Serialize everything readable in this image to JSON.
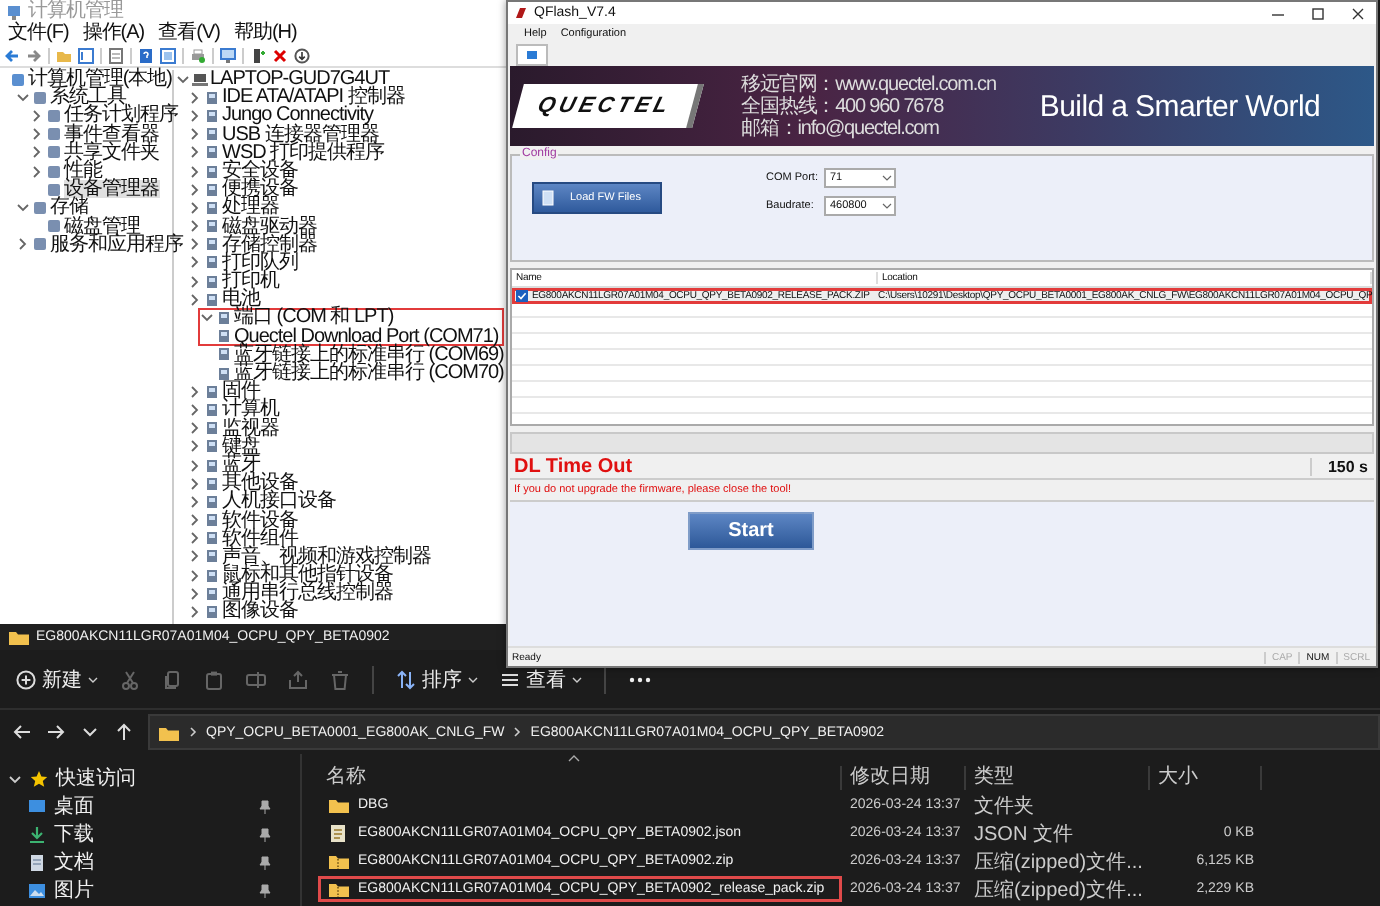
{
  "computer_management": {
    "title": "计算机管理",
    "menu": [
      "文件(F)",
      "操作(A)",
      "查看(V)",
      "帮助(H)"
    ],
    "console_tree": [
      {
        "label": "计算机管理(本地)",
        "selected": false,
        "children": [
          {
            "label": "系统工具",
            "expanded": true,
            "selected": false,
            "children": [
              {
                "label": "任务计划程序",
                "expanded": false,
                "selected": false
              },
              {
                "label": "事件查看器",
                "expanded": false,
                "selected": false
              },
              {
                "label": "共享文件夹",
                "expanded": false,
                "selected": false
              },
              {
                "label": "性能",
                "expanded": false,
                "selected": false
              },
              {
                "label": "设备管理器",
                "selected": true
              }
            ]
          },
          {
            "label": "存储",
            "expanded": true,
            "selected": false,
            "children": [
              {
                "label": "磁盘管理",
                "selected": false
              }
            ]
          },
          {
            "label": "服务和应用程序",
            "expanded": false,
            "selected": false
          }
        ]
      }
    ],
    "device_tree": {
      "label": "LAPTOP-GUD7G4UT",
      "expanded": true,
      "highlighted": false,
      "children": [
        {
          "label": "IDE ATA/ATAPI 控制器",
          "expanded": false,
          "highlighted": false
        },
        {
          "label": "Jungo Connectivity",
          "expanded": false,
          "highlighted": false
        },
        {
          "label": "USB 连接器管理器",
          "expanded": false,
          "highlighted": false
        },
        {
          "label": "WSD 打印提供程序",
          "expanded": false,
          "highlighted": false
        },
        {
          "label": "安全设备",
          "expanded": false,
          "highlighted": false
        },
        {
          "label": "便携设备",
          "expanded": false,
          "highlighted": false
        },
        {
          "label": "处理器",
          "expanded": false,
          "highlighted": false
        },
        {
          "label": "磁盘驱动器",
          "expanded": false,
          "highlighted": false
        },
        {
          "label": "存储控制器",
          "expanded": false,
          "highlighted": false
        },
        {
          "label": "打印队列",
          "expanded": false,
          "highlighted": false
        },
        {
          "label": "打印机",
          "expanded": false,
          "highlighted": false
        },
        {
          "label": "电池",
          "expanded": false,
          "highlighted": false
        },
        {
          "label": "端口 (COM 和 LPT)",
          "expanded": true,
          "highlighted": true,
          "children": [
            {
              "label": "Quectel Download Port (COM71)",
              "highlighted": true
            },
            {
              "label": "蓝牙链接上的标准串行 (COM69)",
              "highlighted": false
            },
            {
              "label": "蓝牙链接上的标准串行 (COM70)",
              "highlighted": false
            }
          ]
        },
        {
          "label": "固件",
          "expanded": false,
          "highlighted": false
        },
        {
          "label": "计算机",
          "expanded": false,
          "highlighted": false
        },
        {
          "label": "监视器",
          "expanded": false,
          "highlighted": false
        },
        {
          "label": "键盘",
          "expanded": false,
          "highlighted": false
        },
        {
          "label": "蓝牙",
          "expanded": false,
          "highlighted": false
        },
        {
          "label": "其他设备",
          "expanded": false,
          "highlighted": false
        },
        {
          "label": "人机接口设备",
          "expanded": false,
          "highlighted": false
        },
        {
          "label": "软件设备",
          "expanded": false,
          "highlighted": false
        },
        {
          "label": "软件组件",
          "expanded": false,
          "highlighted": false
        },
        {
          "label": "声音、视频和游戏控制器",
          "expanded": false,
          "highlighted": false
        },
        {
          "label": "鼠标和其他指针设备",
          "expanded": false,
          "highlighted": false
        },
        {
          "label": "通用串行总线控制器",
          "expanded": false,
          "highlighted": false
        },
        {
          "label": "图像设备",
          "expanded": false,
          "highlighted": false
        }
      ]
    }
  },
  "qflash": {
    "title": "QFlash_V7.4",
    "menu": [
      "Help",
      "Configuration"
    ],
    "banner": {
      "logo": "QUECTEL",
      "contact": [
        "移远官网：www.quectel.com.cn",
        "全国热线：400 960 7678",
        "邮箱：info@quectel.com"
      ],
      "slogan": "Build a Smarter World"
    },
    "config": {
      "legend": "Config",
      "load_button": "Load FW Files",
      "com_port": {
        "label": "COM Port:",
        "value": "71"
      },
      "baudrate": {
        "label": "Baudrate:",
        "value": "460800"
      }
    },
    "file_list": {
      "columns": [
        "Name",
        "Location"
      ],
      "rows": [
        {
          "name": "EG800AKCN11LGR07A01M04_OCPU_QPY_BETA0902_RELEASE_PACK.ZIP",
          "location": "C:\\Users\\10291\\Desktop\\QPY_OCPU_BETA0001_EG800AK_CNLG_FW\\EG800AKCN11LGR07A01M04_OCPU_QP",
          "checked": true,
          "highlighted": true
        }
      ]
    },
    "progress": {
      "level": 0
    },
    "timeout": {
      "label": "DL Time Out",
      "value": "150 s"
    },
    "warning": "If you do not upgrade the firmware, please close the tool!",
    "start_button": "Start",
    "status_bar": {
      "text": "Ready",
      "indicators": [
        {
          "label": "CAP",
          "on": false
        },
        {
          "label": "NUM",
          "on": true
        },
        {
          "label": "SCRL",
          "on": false
        }
      ]
    }
  },
  "explorer": {
    "title": "EG800AKCN11LGR07A01M04_OCPU_QPY_BETA0902",
    "toolbar": {
      "new": "新建",
      "sort": "排序",
      "view": "查看"
    },
    "breadcrumbs": [
      "QPY_OCPU_BETA0001_EG800AK_CNLG_FW",
      "EG800AKCN11LGR07A01M04_OCPU_QPY_BETA0902"
    ],
    "nav": {
      "label": "快速访问",
      "expanded": true,
      "children": [
        {
          "label": "桌面",
          "pinned": true
        },
        {
          "label": "下载",
          "pinned": true
        },
        {
          "label": "文档",
          "pinned": true
        },
        {
          "label": "图片",
          "pinned": true
        }
      ]
    },
    "columns": [
      "名称",
      "修改日期",
      "类型",
      "大小"
    ],
    "rows": [
      {
        "kind": "folder",
        "name": "DBG",
        "modified": "2026-03-24 13:37",
        "type": "文件夹",
        "highlighted": false
      },
      {
        "kind": "json",
        "name": "EG800AKCN11LGR07A01M04_OCPU_QPY_BETA0902.json",
        "modified": "2026-03-24 13:37",
        "type": "JSON 文件",
        "size": "0 KB",
        "highlighted": false
      },
      {
        "kind": "zip",
        "name": "EG800AKCN11LGR07A01M04_OCPU_QPY_BETA0902.zip",
        "modified": "2026-03-24 13:37",
        "type": "压缩(zipped)文件...",
        "size": "6,125 KB",
        "highlighted": false
      },
      {
        "kind": "zip",
        "name": "EG800AKCN11LGR07A01M04_OCPU_QPY_BETA0902_release_pack.zip",
        "modified": "2026-03-24 13:37",
        "type": "压缩(zipped)文件...",
        "size": "2,229 KB",
        "highlighted": true
      }
    ]
  }
}
